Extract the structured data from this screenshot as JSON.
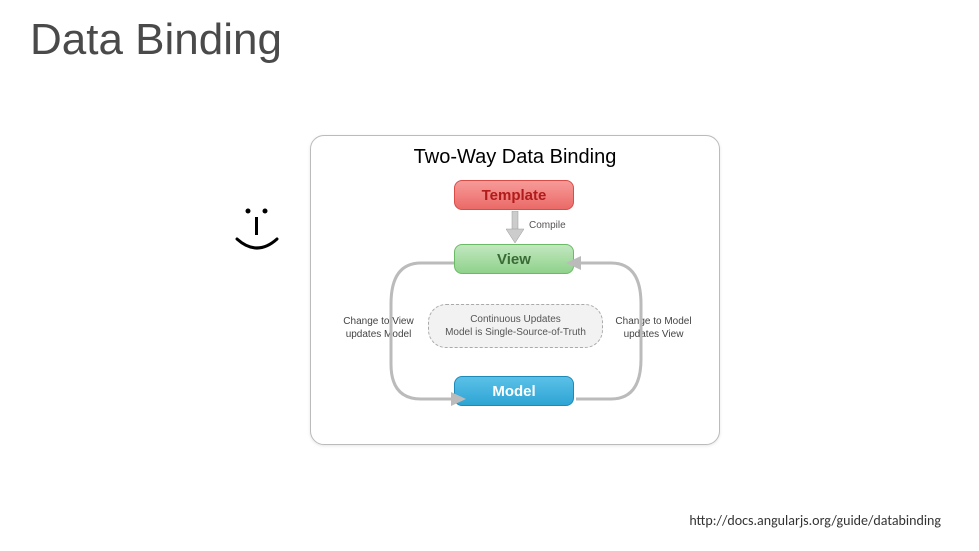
{
  "slide": {
    "title": "Data Binding"
  },
  "diagram": {
    "title": "Two-Way Data Binding",
    "template_label": "Template",
    "view_label": "View",
    "model_label": "Model",
    "compile_label": "Compile",
    "continuous_line1": "Continuous Updates",
    "continuous_line2": "Model is Single-Source-of-Truth",
    "left_caption_line1": "Change to View",
    "left_caption_line2": "updates Model",
    "right_caption_line1": "Change to Model",
    "right_caption_line2": "updates View"
  },
  "source_url": "http://docs.angularjs.org/guide/databinding"
}
